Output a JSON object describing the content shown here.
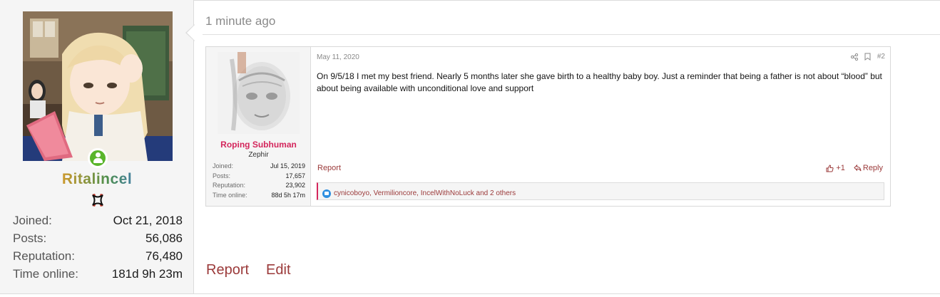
{
  "author": {
    "username": "Ritalincel",
    "stats": [
      {
        "label": "Joined:",
        "value": "Oct 21, 2018"
      },
      {
        "label": "Posts:",
        "value": "56,086"
      },
      {
        "label": "Reputation:",
        "value": "76,480"
      },
      {
        "label": "Time online:",
        "value": "181d 9h 23m"
      }
    ],
    "online_icon": "user-online-icon",
    "rank_icon": "anger-symbol-icon"
  },
  "post": {
    "time_ago": "1 minute ago",
    "footer": {
      "report_label": "Report",
      "edit_label": "Edit"
    }
  },
  "quoted": {
    "username": "Roping Subhuman",
    "user_title": "Zephir",
    "stats": [
      {
        "label": "Joined:",
        "value": "Jul 15, 2019"
      },
      {
        "label": "Posts:",
        "value": "17,657"
      },
      {
        "label": "Reputation:",
        "value": "23,902"
      },
      {
        "label": "Time online:",
        "value": "88d 5h 17m"
      }
    ],
    "date": "May 11, 2020",
    "post_number": "#2",
    "text": "On 9/5/18 I met my best friend. Nearly 5 months later she gave birth to a healthy baby boy. Just a reminder that being a father is not about “blood” but about being available with unconditional love and support",
    "report_label": "Report",
    "like_count": "+1",
    "reply_label": "Reply",
    "reactions_text": "cynicoboyo, Vermilioncore, IncelWithNoLuck and 2 others",
    "colors": {
      "link": "#9b3a3a",
      "username": "#d4265c",
      "like": "#2f8fe0"
    }
  }
}
